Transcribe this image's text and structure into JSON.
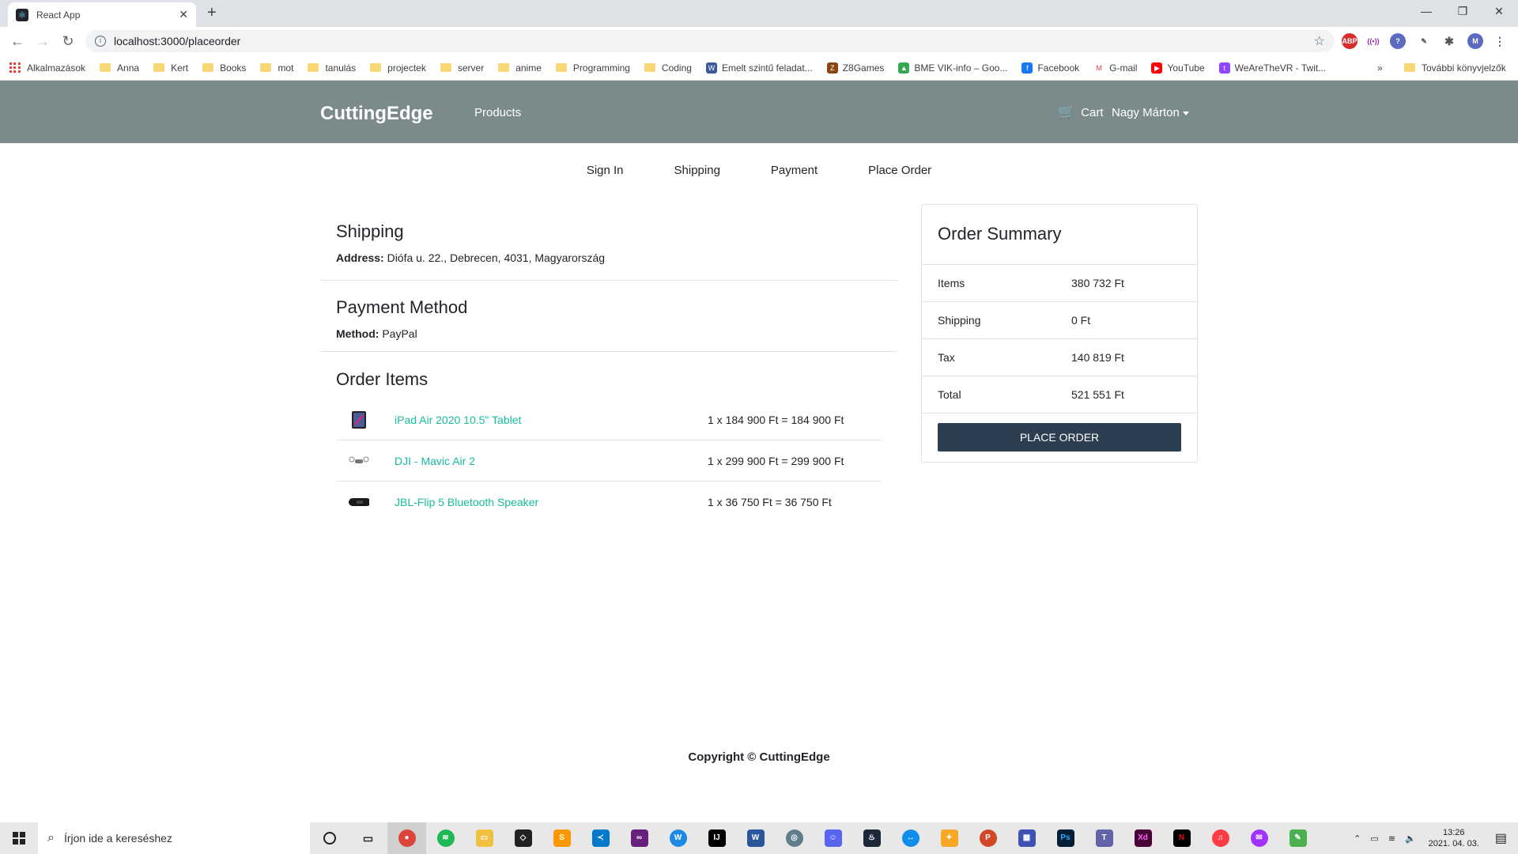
{
  "browser": {
    "tab_title": "React App",
    "url": "localhost:3000/placeorder",
    "bookmarks": [
      "Alkalmazások",
      "Anna",
      "Kert",
      "Books",
      "mot",
      "tanulás",
      "projectek",
      "server",
      "anime",
      "Programming",
      "Coding",
      "Emelt szintű feladat...",
      "Z8Games",
      "BME VIK-info – Goo...",
      "Facebook",
      "G-mail",
      "YouTube",
      "WeAreTheVR - Twit..."
    ],
    "other_bookmarks": "További könyvjelzők",
    "profile_initial": "M"
  },
  "navbar": {
    "brand": "CuttingEdge",
    "products": "Products",
    "cart": "Cart",
    "user": "Nagy Márton"
  },
  "steps": [
    "Sign In",
    "Shipping",
    "Payment",
    "Place Order"
  ],
  "shipping": {
    "heading": "Shipping",
    "label": "Address:",
    "value": "Diófa u. 22., Debrecen, 4031, Magyarország"
  },
  "payment": {
    "heading": "Payment Method",
    "label": "Method:",
    "value": "PayPal"
  },
  "order_items": {
    "heading": "Order Items",
    "items": [
      {
        "name": "iPad Air 2020 10.5\" Tablet",
        "price": "1 x 184 900 Ft = 184 900 Ft"
      },
      {
        "name": "DJI - Mavic Air 2",
        "price": "1 x 299 900 Ft = 299 900 Ft"
      },
      {
        "name": "JBL-Flip 5 Bluetooth Speaker",
        "price": "1 x 36 750 Ft = 36 750 Ft"
      }
    ]
  },
  "summary": {
    "heading": "Order Summary",
    "rows": [
      {
        "label": "Items",
        "value": "380 732 Ft"
      },
      {
        "label": "Shipping",
        "value": "0 Ft"
      },
      {
        "label": "Tax",
        "value": "140 819 Ft"
      },
      {
        "label": "Total",
        "value": "521 551 Ft"
      }
    ],
    "button": "PLACE ORDER"
  },
  "footer": "Copyright © CuttingEdge",
  "taskbar": {
    "search_placeholder": "Írjon ide a kereséshez",
    "time": "13:26",
    "date": "2021. 04. 03."
  }
}
